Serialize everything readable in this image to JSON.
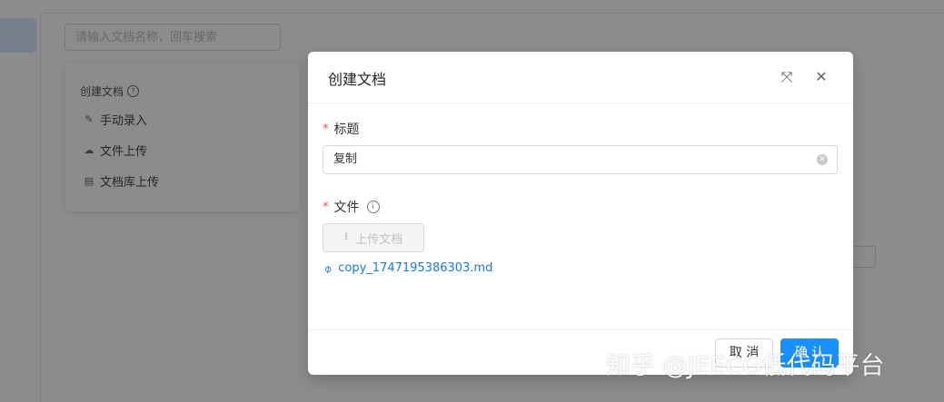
{
  "background": {
    "search_placeholder": "请输入文档名称，回车搜索",
    "create_card": {
      "title": "创建文档",
      "items": [
        {
          "icon": "edit-icon",
          "label": "手动录入"
        },
        {
          "icon": "cloud-upload-icon",
          "label": "文件上传"
        },
        {
          "icon": "library-icon",
          "label": "文档库上传"
        }
      ]
    }
  },
  "modal": {
    "title": "创建文档",
    "fields": {
      "title_label": "标题",
      "title_value": "复制",
      "file_label": "文件",
      "upload_button": "上传文档",
      "uploaded_file": "copy_1747195386303.md"
    },
    "footer": {
      "cancel": "取 消",
      "ok": "确 认"
    }
  },
  "watermark": "知乎 @JEECG低代码平台",
  "colors": {
    "primary": "#1890ff",
    "required": "#ff4d4f",
    "link": "#1677ff"
  }
}
